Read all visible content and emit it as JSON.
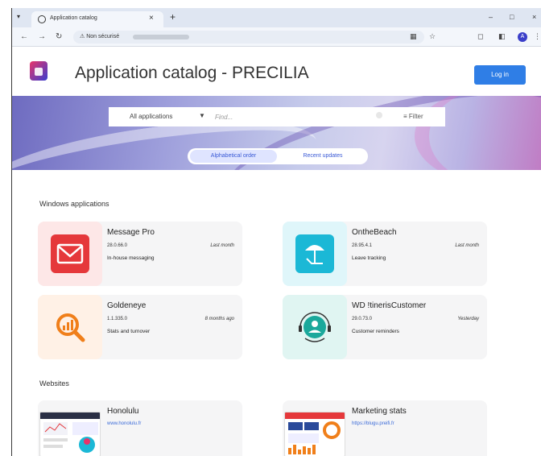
{
  "browser": {
    "tab_title": "Application catalog",
    "tab_close": "×",
    "new_tab": "+",
    "menu_icon": "chevron-down-icon",
    "security_label": "Non sécurisé",
    "win_min": "–",
    "win_max": "□",
    "win_close": "×",
    "profile_initial": "A"
  },
  "header": {
    "title": "Application catalog - PRECILIA",
    "login_label": "Log in"
  },
  "search": {
    "scope_value": "All applications",
    "placeholder": "Find...",
    "filter_label": "Filter"
  },
  "sort_toggle": {
    "options": [
      "Alphabetical order",
      "Recent updates"
    ]
  },
  "sections": {
    "windows_title": "Windows applications",
    "websites_title": "Websites"
  },
  "windows_apps": [
    {
      "name": "Message Pro",
      "version": "28.0.66.0",
      "date": "Last month",
      "description": "In-house messaging",
      "icon": "envelope-icon",
      "color": "#e5383b"
    },
    {
      "name": "OntheBeach",
      "version": "28.95.4.1",
      "date": "Last month",
      "description": "Leave tracking",
      "icon": "beach-umbrella-icon",
      "color": "#1bb8d6"
    },
    {
      "name": "Goldeneye",
      "version": "1.1.335.0",
      "date": "8 months ago",
      "description": "Stats and turnover",
      "icon": "magnifier-chart-icon",
      "color": "#f07f1a"
    },
    {
      "name": "WD !tinerisCustomer",
      "version": "29.0.73.0",
      "date": "Yesterday",
      "description": "Customer reminders",
      "icon": "headset-user-icon",
      "color": "#1aa89b"
    }
  ],
  "websites": [
    {
      "name": "Honolulu",
      "link": "www.honolulu.fr"
    },
    {
      "name": "Marketing stats",
      "link": "https://blugu.preifi.fr"
    }
  ]
}
